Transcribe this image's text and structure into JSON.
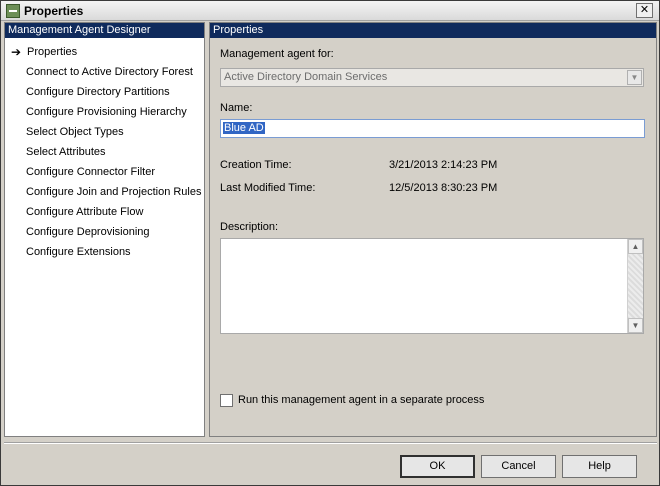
{
  "window": {
    "title": "Properties",
    "close_glyph": "✕",
    "icon": "agent-properties-icon"
  },
  "left_pane": {
    "header": "Management Agent Designer",
    "active_arrow": "➔",
    "items": [
      {
        "label": "Properties",
        "active": true
      },
      {
        "label": "Connect to Active Directory Forest"
      },
      {
        "label": "Configure Directory Partitions"
      },
      {
        "label": "Configure Provisioning Hierarchy"
      },
      {
        "label": "Select Object Types"
      },
      {
        "label": "Select Attributes"
      },
      {
        "label": "Configure Connector Filter"
      },
      {
        "label": "Configure Join and Projection Rules"
      },
      {
        "label": "Configure Attribute Flow"
      },
      {
        "label": "Configure Deprovisioning"
      },
      {
        "label": "Configure Extensions"
      }
    ]
  },
  "right_pane": {
    "header": "Properties",
    "agent_for_label": "Management agent for:",
    "agent_for_value": "Active Directory Domain Services",
    "name_label": "Name:",
    "name_value": "Blue AD",
    "creation_time_label": "Creation Time:",
    "creation_time_value": "3/21/2013 2:14:23 PM",
    "modified_time_label": "Last Modified Time:",
    "modified_time_value": "12/5/2013 8:30:23 PM",
    "description_label": "Description:",
    "description_value": "",
    "separate_process_label": "Run this management agent in a separate process",
    "separate_process_checked": false
  },
  "buttons": {
    "ok": "OK",
    "cancel": "Cancel",
    "help": "Help"
  },
  "colors": {
    "header_bg": "#0f2a5c",
    "selection": "#3166c4"
  }
}
